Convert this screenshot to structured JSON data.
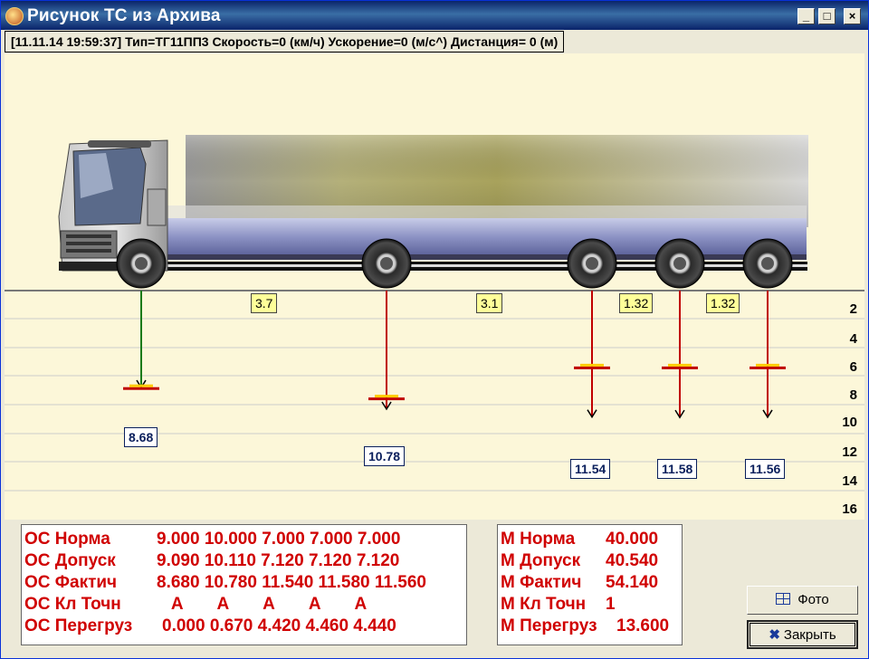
{
  "window": {
    "title": "Рисунок ТС из Архива",
    "minimize": "_",
    "maximize": "□",
    "close": "×"
  },
  "info_bar": "[11.11.14 19:59:37]   Тип=ТГ11ПП3   Скорость=0 (км/ч)   Ускорение=0 (м/с^)   Дистанция= 0 (м)",
  "scale": [
    "2",
    "4",
    "6",
    "8",
    "10",
    "12",
    "14",
    "16"
  ],
  "axle_gaps": [
    "3.7",
    "3.1",
    "1.32",
    "1.32"
  ],
  "axles": [
    {
      "value": "8.68",
      "load": 8.68,
      "norm": 9.0,
      "color": "#1a7a1a"
    },
    {
      "value": "10.78",
      "load": 10.78,
      "norm": 10.0,
      "color": "#c00000"
    },
    {
      "value": "11.54",
      "load": 11.54,
      "norm": 7.0,
      "color": "#c00000"
    },
    {
      "value": "11.58",
      "load": 11.58,
      "norm": 7.0,
      "color": "#c00000"
    },
    {
      "value": "11.56",
      "load": 11.56,
      "norm": 7.0,
      "color": "#c00000"
    }
  ],
  "axle_table": [
    {
      "label": "ОС Норма",
      "values": "9.000 10.000 7.000 7.000 7.000"
    },
    {
      "label": "ОС Допуск",
      "values": "9.090 10.110 7.120 7.120 7.120"
    },
    {
      "label": "ОС Фактич",
      "values": "8.680 10.780 11.540 11.580 11.560"
    },
    {
      "label": "ОС Кл Точн",
      "values": "   А       А       А       А       А"
    },
    {
      "label": "ОС Перегруз",
      "values": "0.000 0.670 4.420 4.460 4.440"
    }
  ],
  "mass_table": [
    {
      "label": "М Норма",
      "value": "40.000"
    },
    {
      "label": "М Допуск",
      "value": "40.540"
    },
    {
      "label": "М Фактич",
      "value": "54.140"
    },
    {
      "label": "М Кл Точн",
      "value": "1"
    },
    {
      "label": "М Перегруз",
      "value": "13.600"
    }
  ],
  "buttons": {
    "photo": "Фото",
    "close": "Закрыть"
  }
}
